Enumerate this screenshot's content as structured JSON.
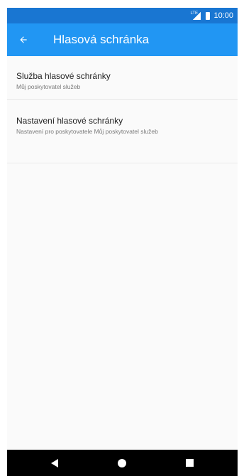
{
  "status_bar": {
    "network": "LTE",
    "time": "10:00"
  },
  "app_bar": {
    "title": "Hlasová schránka",
    "back_icon": "arrow-back-icon"
  },
  "list": [
    {
      "title": "Služba hlasové schránky",
      "summary": "Můj poskytovatel služeb"
    },
    {
      "title": "Nastavení hlasové schránky",
      "summary": "Nastavení pro poskytovatele Můj poskytovatel služeb"
    }
  ],
  "nav_bar": {
    "back_icon": "nav-back-icon",
    "home_icon": "nav-home-icon",
    "recents_icon": "nav-recents-icon"
  },
  "colors": {
    "status_bar": "#1976d2",
    "app_bar": "#2196f3",
    "background": "#fafafa",
    "nav_bar": "#000000"
  }
}
